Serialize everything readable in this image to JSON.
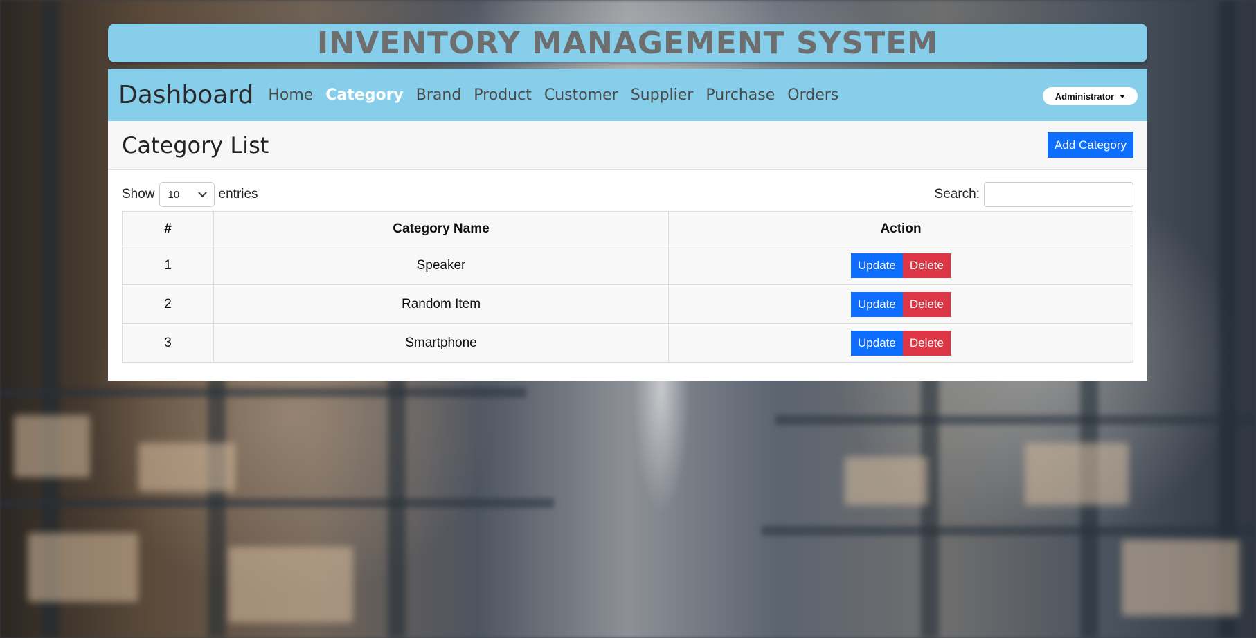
{
  "header": {
    "system_title": "INVENTORY MANAGEMENT SYSTEM"
  },
  "navbar": {
    "brand": "Dashboard",
    "links": [
      {
        "label": "Home",
        "active": false
      },
      {
        "label": "Category",
        "active": true
      },
      {
        "label": "Brand",
        "active": false
      },
      {
        "label": "Product",
        "active": false
      },
      {
        "label": "Customer",
        "active": false
      },
      {
        "label": "Supplier",
        "active": false
      },
      {
        "label": "Purchase",
        "active": false
      },
      {
        "label": "Orders",
        "active": false
      }
    ],
    "user_menu": "Administrator"
  },
  "page": {
    "title": "Category List",
    "add_button": "Add Category"
  },
  "table_controls": {
    "show_label": "Show",
    "entries_value": "10",
    "entries_label": "entries",
    "search_label": "Search:",
    "search_value": ""
  },
  "table": {
    "columns": [
      "#",
      "Category Name",
      "Action"
    ],
    "rows": [
      {
        "num": "1",
        "name": "Speaker"
      },
      {
        "num": "2",
        "name": "Random Item"
      },
      {
        "num": "3",
        "name": "Smartphone"
      }
    ],
    "update_label": "Update",
    "delete_label": "Delete"
  },
  "colors": {
    "header_bg": "#87ceeb",
    "primary": "#0d6efd",
    "danger": "#dc3545"
  }
}
